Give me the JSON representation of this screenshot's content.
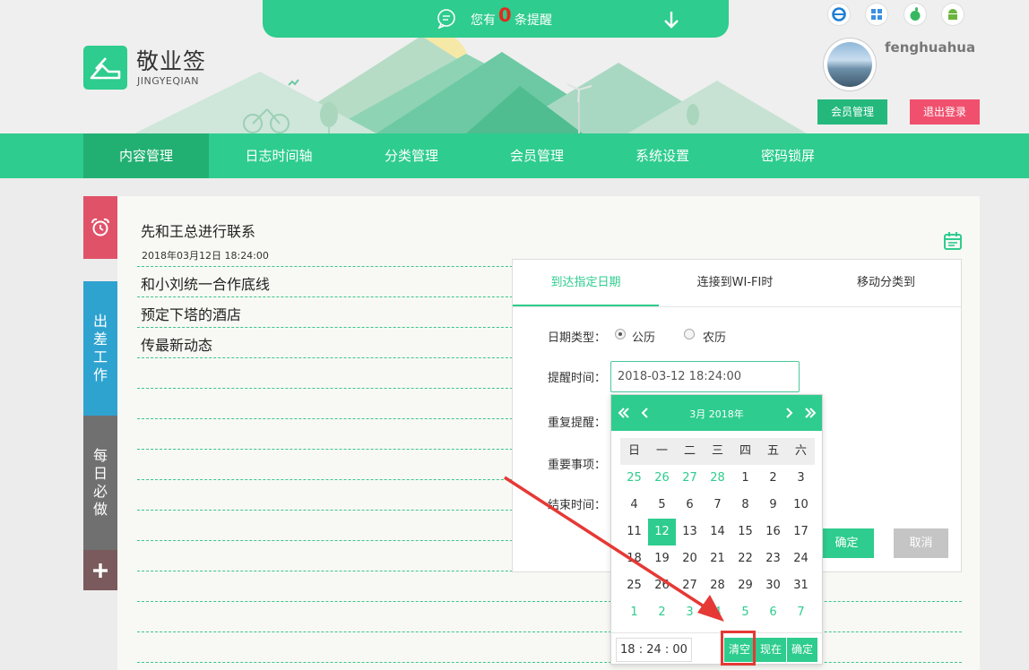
{
  "notice": {
    "prefix": "您有",
    "count": "0",
    "suffix": "条提醒"
  },
  "logo": {
    "title": "敬业签",
    "subtitle": "JINGYEQIAN"
  },
  "platforms": [
    "ie-icon",
    "windows-icon",
    "apple-icon",
    "android-icon"
  ],
  "user": {
    "name": "fenghuahua",
    "member_btn": "会员管理",
    "logout_btn": "退出登录"
  },
  "nav": [
    "内容管理",
    "日志时间轴",
    "分类管理",
    "会员管理",
    "系统设置",
    "密码锁屏"
  ],
  "side_tabs": [
    {
      "label": "",
      "icon": "alarm-clock-icon",
      "color": "#e05268"
    },
    {
      "label": "出差工作",
      "color": "#2ea3d0"
    },
    {
      "label": "每日必做",
      "color": "#707070"
    },
    {
      "label": "+",
      "icon": "plus-icon",
      "color": "#7a5a5c"
    }
  ],
  "notes": [
    {
      "title": "先和王总进行联系",
      "date": "2018年03月12日 18:24:00"
    },
    {
      "title": "和小刘统一合作底线"
    },
    {
      "title": "预定下塔的酒店"
    },
    {
      "title": "传最新动态"
    }
  ],
  "panel": {
    "tabs": [
      "到达指定日期",
      "连接到WI-FI时",
      "移动分类到"
    ],
    "date_type_label": "日期类型：",
    "solar": "公历",
    "lunar": "农历",
    "remind_time_label": "提醒时间：",
    "remind_time_value": "2018-03-12 18:24:00",
    "repeat_label": "重复提醒：",
    "important_label": "重要事项：",
    "end_time_label": "结束时间：",
    "ok": "确定",
    "cancel": "取消"
  },
  "picker": {
    "title": "3月 2018年",
    "weekdays": [
      "日",
      "一",
      "二",
      "三",
      "四",
      "五",
      "六"
    ],
    "weeks": [
      [
        "25",
        "26",
        "27",
        "28",
        "1",
        "2",
        "3"
      ],
      [
        "4",
        "5",
        "6",
        "7",
        "8",
        "9",
        "10"
      ],
      [
        "11",
        "12",
        "13",
        "14",
        "15",
        "16",
        "17"
      ],
      [
        "18",
        "19",
        "20",
        "21",
        "22",
        "23",
        "24"
      ],
      [
        "25",
        "26",
        "27",
        "28",
        "29",
        "30",
        "31"
      ],
      [
        "1",
        "2",
        "3",
        "4",
        "5",
        "6",
        "7"
      ]
    ],
    "selected_day": "12",
    "time": "18 : 24 : 00",
    "clear": "清空",
    "now": "现在",
    "confirm": "确定"
  },
  "colors": {
    "accent": "#2ecc8e",
    "danger": "#f0506e",
    "highlight": "#e53935"
  }
}
